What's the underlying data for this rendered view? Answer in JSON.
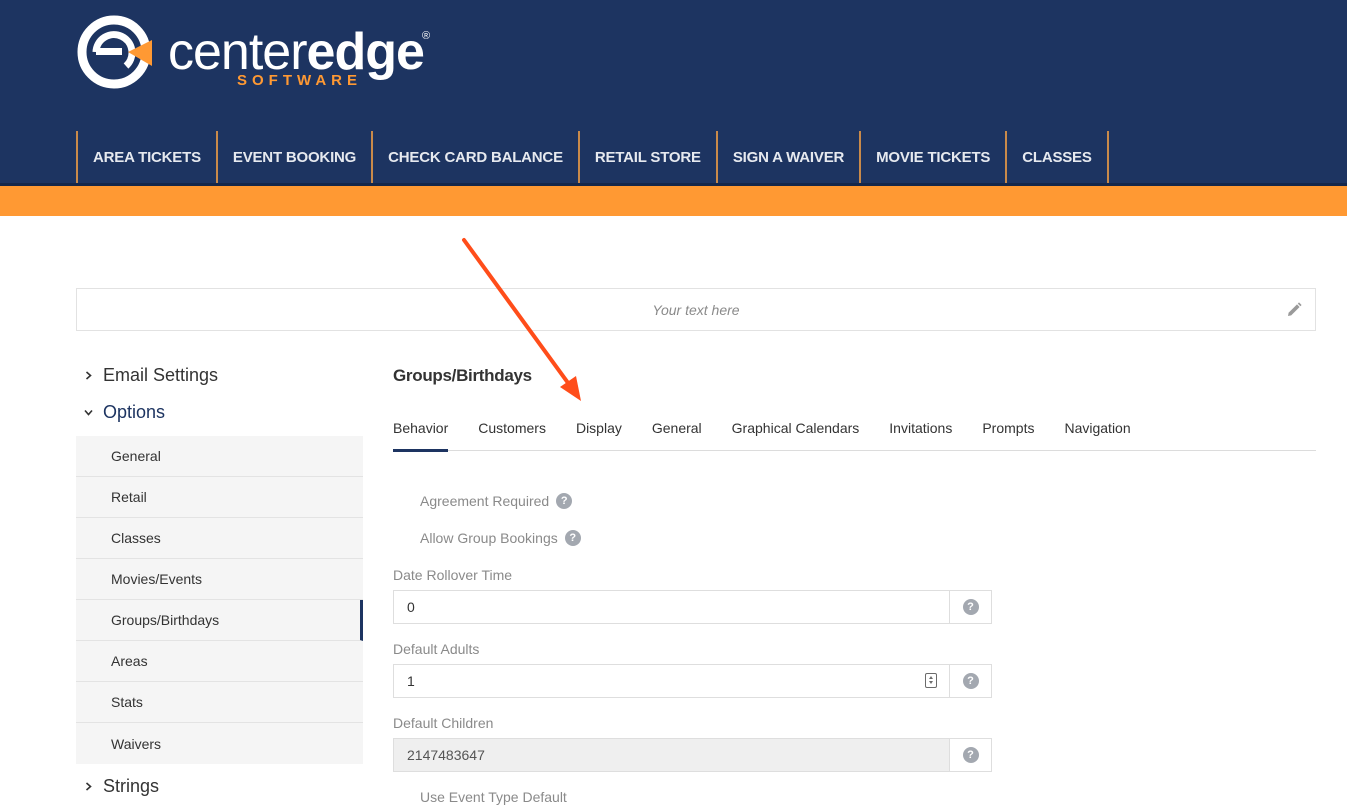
{
  "brand": {
    "name_light": "center",
    "name_bold": "edge",
    "registered": "®",
    "subtitle": "SOFTWARE"
  },
  "nav": {
    "items": [
      {
        "label": "AREA TICKETS"
      },
      {
        "label": "EVENT BOOKING"
      },
      {
        "label": "CHECK CARD BALANCE"
      },
      {
        "label": "RETAIL STORE"
      },
      {
        "label": "SIGN A WAIVER"
      },
      {
        "label": "MOVIE TICKETS"
      },
      {
        "label": "CLASSES"
      }
    ]
  },
  "banner": {
    "placeholder": "Your text here",
    "edit_icon": "pencil-icon"
  },
  "sidebar": {
    "email_settings": "Email Settings",
    "options": "Options",
    "items": [
      {
        "label": "General"
      },
      {
        "label": "Retail"
      },
      {
        "label": "Classes"
      },
      {
        "label": "Movies/Events"
      },
      {
        "label": "Groups/Birthdays"
      },
      {
        "label": "Areas"
      },
      {
        "label": "Stats"
      },
      {
        "label": "Waivers"
      }
    ],
    "strings": "Strings"
  },
  "main": {
    "title": "Groups/Birthdays",
    "tabs": [
      {
        "label": "Behavior"
      },
      {
        "label": "Customers"
      },
      {
        "label": "Display"
      },
      {
        "label": "General"
      },
      {
        "label": "Graphical Calendars"
      },
      {
        "label": "Invitations"
      },
      {
        "label": "Prompts"
      },
      {
        "label": "Navigation"
      }
    ],
    "agreement_required": "Agreement Required",
    "allow_group_bookings": "Allow Group Bookings",
    "date_rollover_label": "Date Rollover Time",
    "date_rollover_value": "0",
    "default_adults_label": "Default Adults",
    "default_adults_value": "1",
    "default_children_label": "Default Children",
    "default_children_value": "2147483647",
    "use_event_type_default": "Use Event Type Default",
    "help_glyph": "?"
  },
  "colors": {
    "header": "#1d3461",
    "accent": "#ff9933",
    "annotation_arrow": "#ff4d1a"
  }
}
